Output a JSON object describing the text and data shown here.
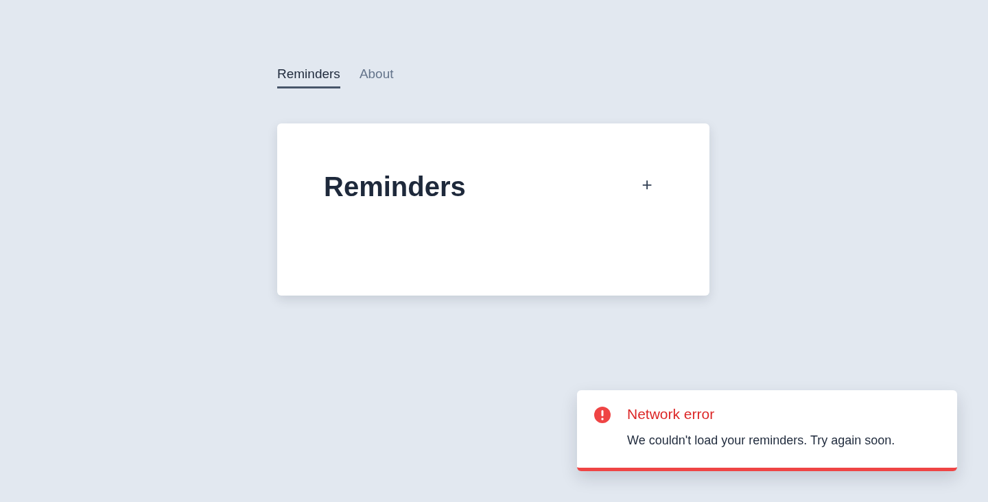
{
  "tabs": [
    {
      "label": "Reminders",
      "selected": true
    },
    {
      "label": "About",
      "selected": false
    }
  ],
  "card": {
    "title": "Reminders",
    "add_button": "+"
  },
  "toast": {
    "title": "Network error",
    "message": "We couldn't load your reminders. Try again soon."
  }
}
